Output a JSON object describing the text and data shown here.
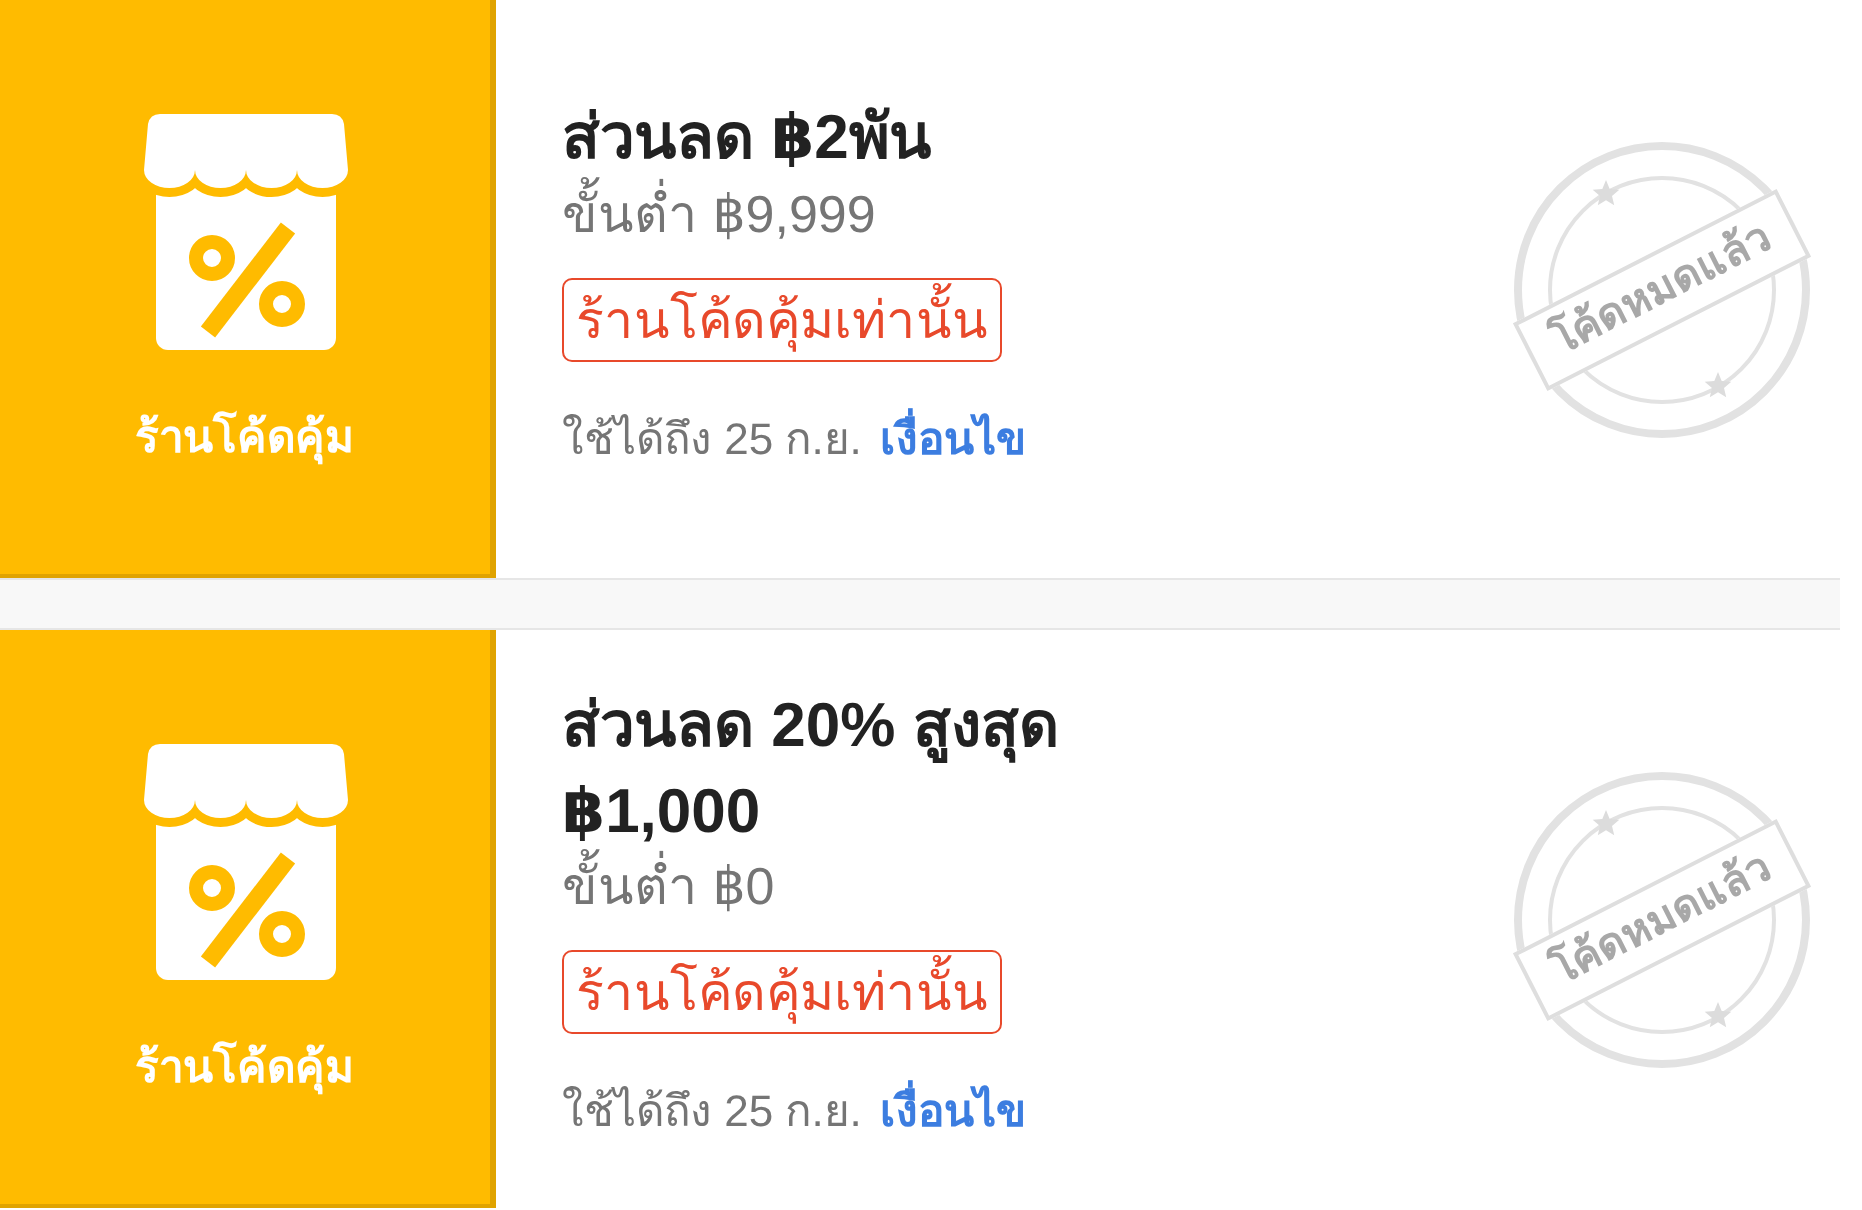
{
  "vouchers": [
    {
      "shop_label": "ร้านโค้ดคุ้ม",
      "title": "ส่วนลด ฿2พัน",
      "min_spend": "ขั้นต่ำ ฿9,999",
      "tag": "ร้านโค้ดคุ้มเท่านั้น",
      "validity": "ใช้ได้ถึง 25 ก.ย.",
      "terms_link": "เงื่อนไข",
      "stamp": "โค้ดหมดแล้ว"
    },
    {
      "shop_label": "ร้านโค้ดคุ้ม",
      "title": "ส่วนลด 20% สูงสุด ฿1,000",
      "min_spend": "ขั้นต่ำ ฿0",
      "tag": "ร้านโค้ดคุ้มเท่านั้น",
      "validity": "ใช้ได้ถึง 25 ก.ย.",
      "terms_link": "เงื่อนไข",
      "stamp": "โค้ดหมดแล้ว"
    }
  ]
}
